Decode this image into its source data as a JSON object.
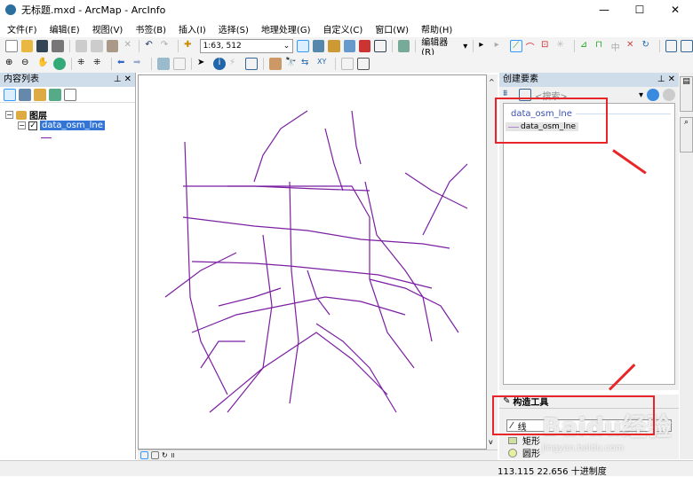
{
  "window": {
    "title": "无标题.mxd - ArcMap - ArcInfo"
  },
  "menu": [
    "文件(F)",
    "编辑(E)",
    "视图(V)",
    "书签(B)",
    "插入(I)",
    "选择(S)",
    "地理处理(G)",
    "自定义(C)",
    "窗口(W)",
    "帮助(H)"
  ],
  "toolbar": {
    "scale": "1:63, 512",
    "editor_label": "编辑器(R)"
  },
  "toc": {
    "title": "内容列表",
    "group": "图层",
    "layer": "data_osm_lne",
    "layer_checked": true
  },
  "create_features": {
    "title": "创建要素",
    "search_placeholder": "<搜索>",
    "group": "data_osm_lne",
    "template": "data_osm_lne"
  },
  "construct_tools": {
    "title": "构造工具",
    "items": [
      "线",
      "矩形",
      "圆形"
    ]
  },
  "status": {
    "coords": "113.115  22.656 十进制度"
  },
  "watermark": {
    "text": "Baidu经验",
    "url": "jingyan.baidu.com"
  },
  "colors": {
    "road": "#7b1fa2",
    "highlight": "#e8262a",
    "panel_header": "#cfdcea"
  }
}
